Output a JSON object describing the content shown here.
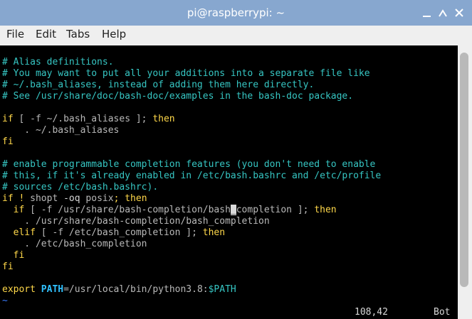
{
  "window": {
    "title": "pi@raspberrypi: ~"
  },
  "menu": [
    "File",
    "Edit",
    "Tabs",
    "Help"
  ],
  "editor": {
    "line1": "# Alias definitions.",
    "line2": "# You may want to put all your additions into a separate file like",
    "line3": "# ~/.bash_aliases, instead of adding them here directly.",
    "line4": "# See /usr/share/doc/bash-doc/examples in the bash-doc package.",
    "line6_kw1": "if",
    "line6_txt": " [ -f ~/.bash_aliases ]; ",
    "line6_kw2": "then",
    "line7": "    . ~/.bash_aliases",
    "line8": "fi",
    "line10": "# enable programmable completion features (you don't need to enable",
    "line11": "# this, if it's already enabled in /etc/bash.bashrc and /etc/profile",
    "line12": "# sources /etc/bash.bashrc).",
    "line13_kw1": "if",
    "line13_bang": " ! ",
    "line13_cmd": "shopt",
    "line13_opt": " -oq ",
    "line13_arg": "posix",
    "line13_semi": "; ",
    "line13_kw2": "then",
    "line14_indent": "  ",
    "line14_kw1": "if",
    "line14_txt_a": " [ -f /usr/share/bash-completion/bash",
    "line14_cursor": "_",
    "line14_txt_b": "completion ]; ",
    "line14_kw2": "then",
    "line15": "    . /usr/share/bash-completion/bash_completion",
    "line16_indent": "  ",
    "line16_kw1": "elif",
    "line16_txt": " [ -f /etc/bash_completion ]; ",
    "line16_kw2": "then",
    "line17": "    . /etc/bash_completion",
    "line18": "  fi",
    "line19": "fi",
    "line21_kw": "export",
    "line21_var": " PATH",
    "line21_val": "=/usr/local/bin/python3.8:",
    "line21_env": "$PATH",
    "tilde": "~"
  },
  "status": {
    "position": "108,42",
    "scroll": "Bot"
  }
}
